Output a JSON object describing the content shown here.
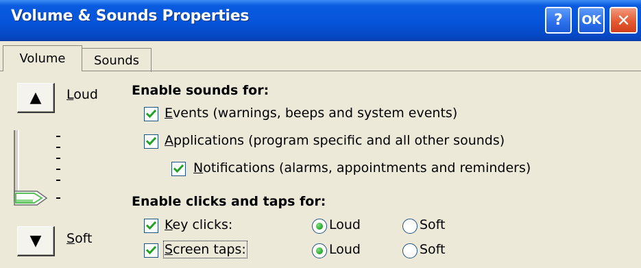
{
  "window": {
    "title": "Volume & Sounds Properties",
    "help_label": "?",
    "ok_label": "OK",
    "close_label": "✕"
  },
  "tabs": [
    {
      "label": "Volume",
      "selected": true
    },
    {
      "label": "Sounds",
      "selected": false
    }
  ],
  "volume": {
    "up_icon": "▲",
    "down_icon": "▼",
    "loud_label": "Loud",
    "soft_label": "Soft",
    "level_fraction": 0.0
  },
  "enable_sounds": {
    "heading": "Enable sounds for:",
    "options": [
      {
        "label": "Events (warnings, beeps and system events)",
        "checked": true
      },
      {
        "label": "Applications (program specific and all other sounds)",
        "checked": true
      },
      {
        "label": "Notifications (alarms, appointments and reminders)",
        "checked": true
      }
    ]
  },
  "enable_clicks": {
    "heading": "Enable clicks and taps for:",
    "rows": [
      {
        "label": "Key clicks:",
        "checked": true,
        "loud": "Loud",
        "soft": "Soft",
        "selected": "Loud"
      },
      {
        "label": "Screen taps:",
        "checked": true,
        "loud": "Loud",
        "soft": "Soft",
        "selected": "Loud"
      }
    ]
  },
  "colors": {
    "titlebar": "#0654DA",
    "face": "#ECE9D8",
    "check": "#21A121",
    "close": "#E55A33"
  }
}
